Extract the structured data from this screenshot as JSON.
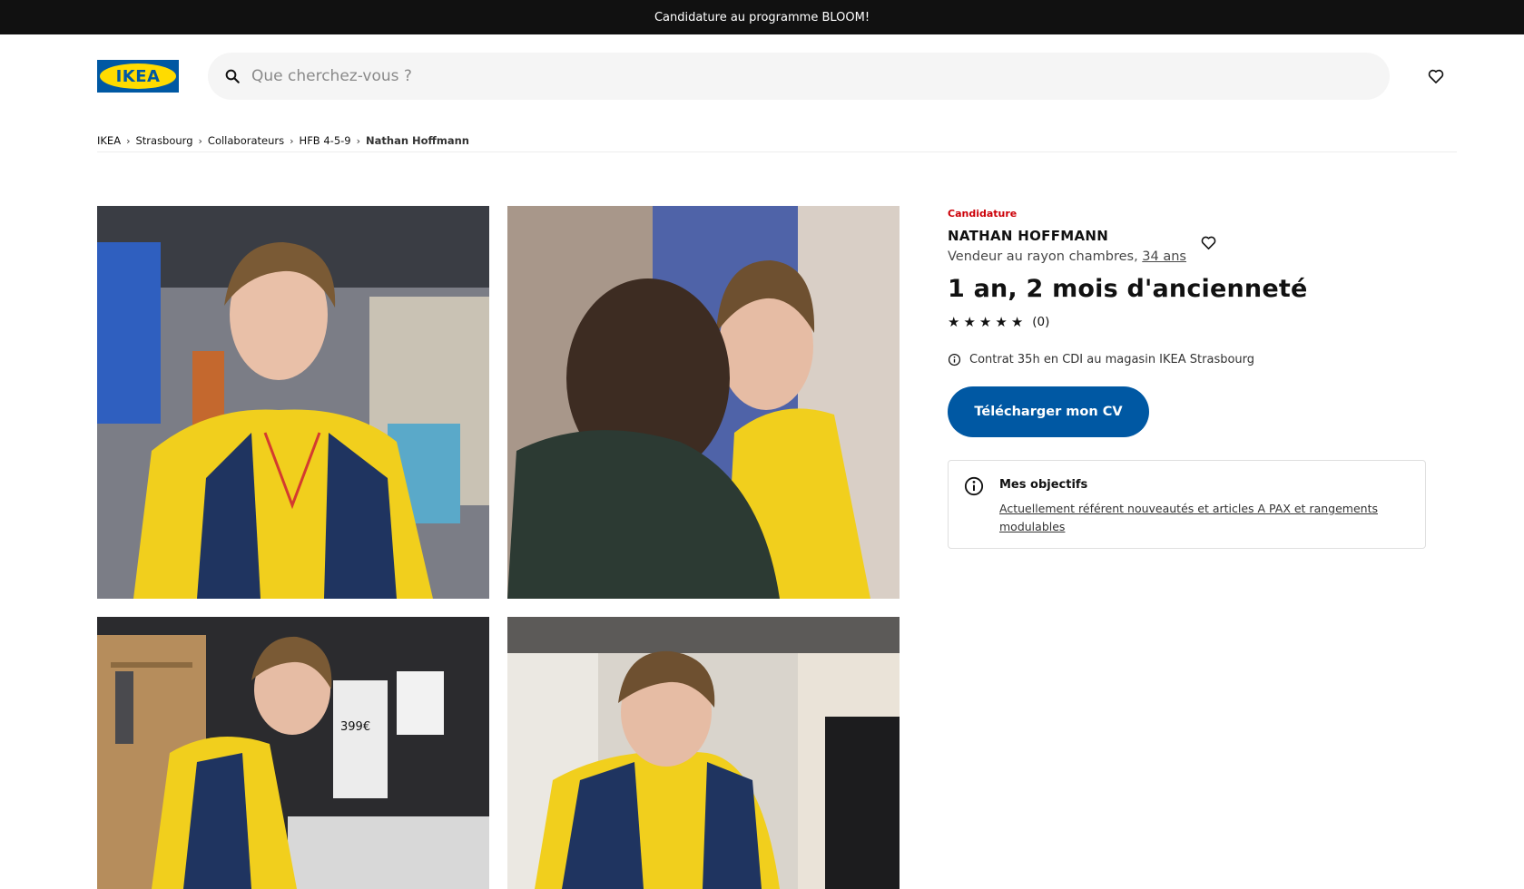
{
  "banner": {
    "text": "Candidature au programme BLOOM!"
  },
  "header": {
    "logo_text": "IKEA",
    "search_placeholder": "Que cherchez-vous ?",
    "icons": {
      "search": "search-icon",
      "favorites": "heart-icon"
    }
  },
  "breadcrumb": {
    "items": [
      "IKEA",
      "Strasbourg",
      "Collaborateurs",
      "HFB 4-5-9"
    ],
    "current": "Nathan Hoffmann"
  },
  "gallery": {
    "photos": [
      "portrait-smiling",
      "talking-with-customer",
      "arranging-bedding-price-399",
      "working-at-computer"
    ],
    "price_tag": "399€"
  },
  "profile": {
    "eyebrow": "Candidature",
    "name": "NATHAN HOFFMANN",
    "role": "Vendeur au rayon chambres,",
    "age": "34 ans",
    "seniority": "1 an, 2 mois d'ancienneté",
    "rating_stars": 5,
    "rating_count": "(0)",
    "contract": "Contrat 35h en CDI au magasin IKEA Strasbourg",
    "cv_button": "Télécharger mon CV",
    "objectives": {
      "title": "Mes objectifs",
      "text": "Actuellement référent nouveautés et articles A PAX et rangements modulables"
    }
  },
  "colors": {
    "brand_blue": "#0058a3",
    "brand_yellow": "#ffdb00",
    "eyebrow_red": "#cc0008",
    "topbar": "#111111"
  }
}
